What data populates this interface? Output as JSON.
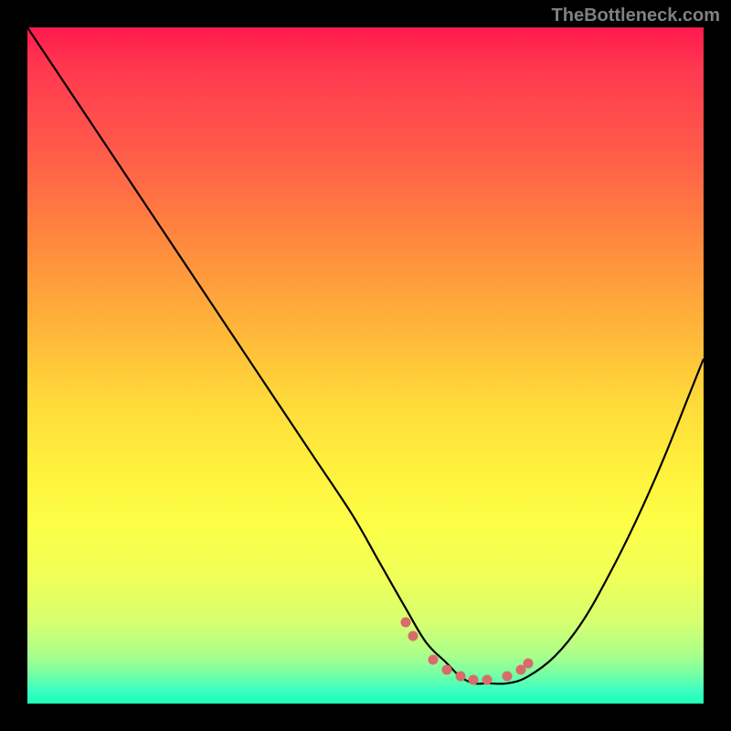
{
  "watermark": "TheBottleneck.com",
  "chart_data": {
    "type": "line",
    "title": "",
    "xlabel": "",
    "ylabel": "",
    "xlim": [
      0,
      100
    ],
    "ylim": [
      0,
      100
    ],
    "grid": false,
    "series": [
      {
        "name": "bottleneck-curve",
        "x": [
          0,
          6,
          12,
          18,
          24,
          30,
          36,
          42,
          48,
          52,
          56,
          59,
          62,
          64,
          66,
          68,
          71,
          74,
          78,
          82,
          86,
          90,
          94,
          98,
          100
        ],
        "y": [
          100,
          91,
          82,
          73,
          64,
          55,
          46,
          37,
          28,
          21,
          14,
          9,
          6,
          4,
          3,
          3,
          3,
          4,
          7,
          12,
          19,
          27,
          36,
          46,
          51
        ]
      }
    ],
    "markers": {
      "name": "highlight-points",
      "color": "#d96b6b",
      "points": [
        {
          "x": 56.0,
          "y": 12.0
        },
        {
          "x": 57.0,
          "y": 10.0
        },
        {
          "x": 60.0,
          "y": 6.5
        },
        {
          "x": 62.0,
          "y": 5.0
        },
        {
          "x": 64.0,
          "y": 4.0
        },
        {
          "x": 66.0,
          "y": 3.5
        },
        {
          "x": 68.0,
          "y": 3.5
        },
        {
          "x": 71.0,
          "y": 4.0
        },
        {
          "x": 73.0,
          "y": 5.0
        },
        {
          "x": 74.0,
          "y": 6.0
        }
      ]
    }
  }
}
